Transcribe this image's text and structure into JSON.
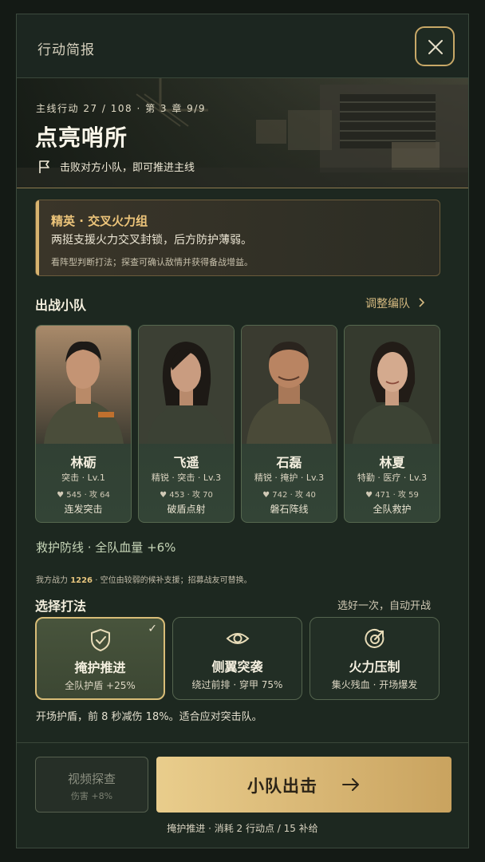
{
  "header": {
    "title": "行动简报"
  },
  "banner": {
    "meta": "主线行动 27 / 108 · 第 3 章 9/9",
    "title": "点亮哨所",
    "objective": "击败对方小队，即可推进主线"
  },
  "elite": {
    "title": "精英 · 交叉火力组",
    "desc": "两挺支援火力交叉封锁，后方防护薄弱。",
    "tip": "看阵型判断打法；探查可确认敌情并获得备战增益。"
  },
  "squad": {
    "title": "出战小队",
    "adjust": "调整编队",
    "members": [
      {
        "name": "林砺",
        "role": "突击 · Lv.1",
        "stats": "♥ 545 · 攻 64",
        "skill": "连发突击"
      },
      {
        "name": "飞遥",
        "role": "精锐 · 突击 · Lv.3",
        "stats": "♥ 453 · 攻 70",
        "skill": "破盾点射"
      },
      {
        "name": "石磊",
        "role": "精锐 · 掩护 · Lv.3",
        "stats": "♥ 742 · 攻 40",
        "skill": "磐石阵线"
      },
      {
        "name": "林夏",
        "role": "特勤 · 医疗 · Lv.3",
        "stats": "♥ 471 · 攻 59",
        "skill": "全队救护"
      }
    ],
    "bonus": "救护防线 · 全队血量 +6%",
    "power_prefix": "我方战力",
    "power_value": "1226",
    "power_suffix": "· 空位由较弱的候补支援；招募战友可替换。"
  },
  "tactics": {
    "title": "选择打法",
    "hint": "选好一次，自动开战",
    "options": [
      {
        "name": "掩护推进",
        "sub": "全队护盾 +25%",
        "icon": "shield-check-icon",
        "selected": true
      },
      {
        "name": "侧翼突袭",
        "sub": "绕过前排 · 穿甲 75%",
        "icon": "eye-icon",
        "selected": false
      },
      {
        "name": "火力压制",
        "sub": "集火残血 · 开场爆发",
        "icon": "target-icon",
        "selected": false
      }
    ],
    "check": "✓",
    "desc": "开场护盾，前 8 秒减伤 18%。适合应对突击队。"
  },
  "footer": {
    "video_label": "视频探查",
    "video_sub": "伤害 +8%",
    "deploy_label": "小队出击",
    "cost": "掩护推进 · 消耗 2 行动点 / 15 补给"
  },
  "colors": {
    "accent": "#d8b674",
    "panel": "#1d2820",
    "selected": "#d9bd78"
  }
}
